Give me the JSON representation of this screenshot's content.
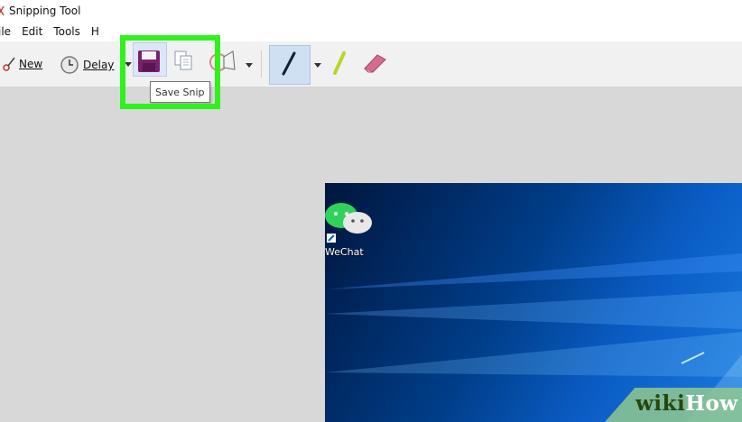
{
  "window": {
    "title": "Snipping Tool"
  },
  "menu": [
    "ile",
    "Edit",
    "Tools",
    "H"
  ],
  "toolbar": {
    "new_label": "New",
    "delay_label": "Delay",
    "tooltip": "Save Snip"
  },
  "desktop": {
    "icon_label": "WeChat"
  },
  "watermark": {
    "part1": "wiki",
    "part2": "How"
  },
  "colors": {
    "highlight": "#2ff21b",
    "desktop": "#0a4fae"
  }
}
